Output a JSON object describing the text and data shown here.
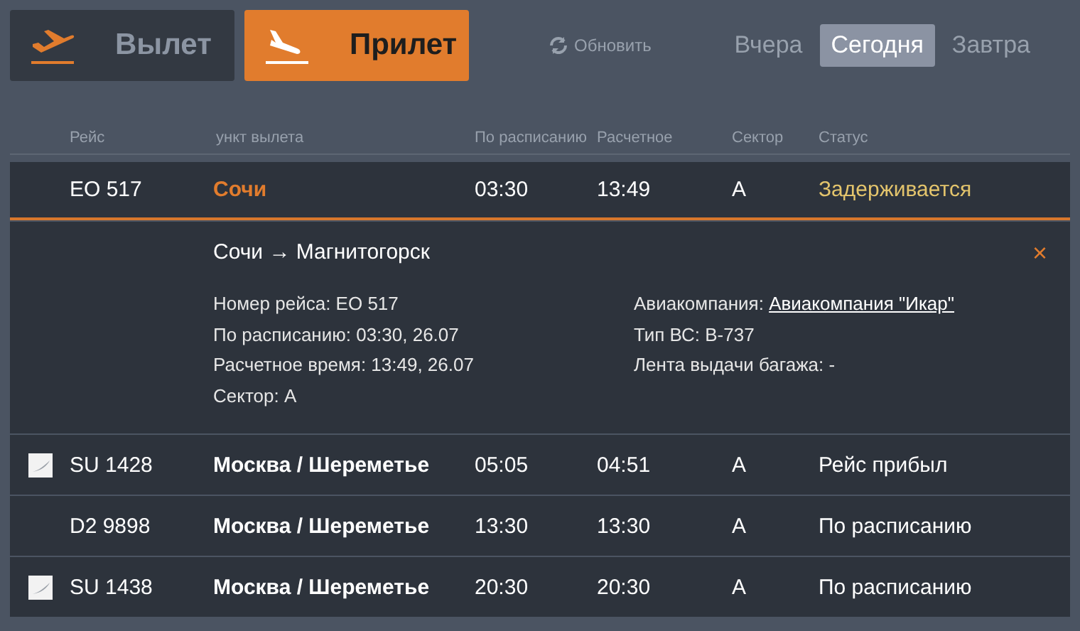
{
  "direction_tabs": [
    {
      "label": "Вылет",
      "kind": "departure",
      "selected": false
    },
    {
      "label": "Прилет",
      "kind": "arrival",
      "selected": true
    }
  ],
  "refresh": {
    "label": "Обновить"
  },
  "day_tabs": [
    {
      "label": "Вчера",
      "selected": false
    },
    {
      "label": "Сегодня",
      "selected": true
    },
    {
      "label": "Завтра",
      "selected": false
    }
  ],
  "table": {
    "columns": [
      "Рейс",
      "ункт вылета",
      "По расписанию",
      "Расчетное",
      "Сектор",
      "Статус"
    ],
    "rows": [
      {
        "flight": "EO 517",
        "city": "Сочи",
        "scheduled": "03:30",
        "estimated": "13:49",
        "sector": "A",
        "status": "Задерживается",
        "color": "#e3c46c",
        "has_logo": false,
        "expanded": true,
        "details": {
          "route": "Сочи → Магнитогорск",
          "close": "×",
          "left": [
            "Номер рейса: EO 517",
            "По расписанию: 03:30, 26.07",
            "Расчетное время: 13:49, 26.07",
            "Сектор: A"
          ],
          "airline_label": "Авиакомпания:",
          "airline": "Авиакомпания \"Икар\"",
          "right": [
            "Тип ВС: B-737",
            "Лента выдачи багажа: -"
          ]
        }
      },
      {
        "flight": "SU 1428",
        "city": "Москва / Шереметье",
        "scheduled": "05:05",
        "estimated": "04:51",
        "sector": "A",
        "status": "Рейс прибыл",
        "color": "#ffffff",
        "has_logo": true,
        "expanded": false
      },
      {
        "flight": "D2 9898",
        "city": "Москва / Шереметье",
        "scheduled": "13:30",
        "estimated": "13:30",
        "sector": "A",
        "status": "По расписанию",
        "color": "#ffffff",
        "has_logo": false,
        "expanded": false
      },
      {
        "flight": "SU 1438",
        "city": "Москва / Шереметье",
        "scheduled": "20:30",
        "estimated": "20:30",
        "sector": "A",
        "status": "По расписанию",
        "color": "#ffffff",
        "has_logo": true,
        "expanded": false
      }
    ]
  }
}
